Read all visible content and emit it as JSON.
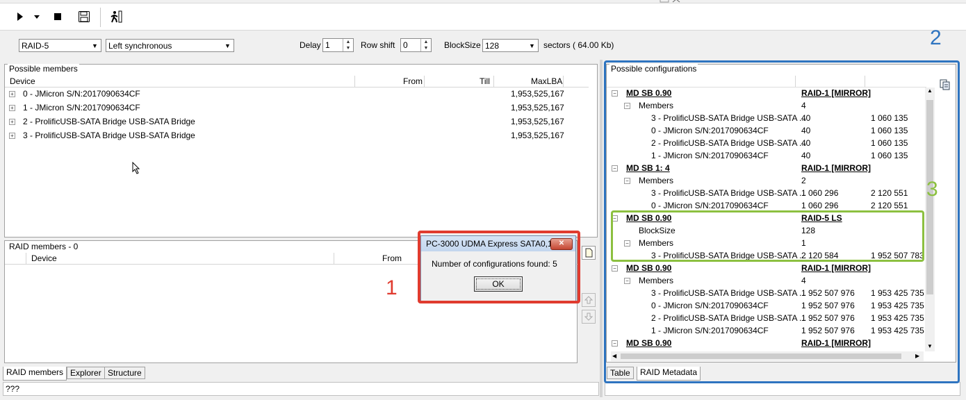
{
  "toolbar": {
    "buttons": [
      {
        "name": "play-icon",
        "glyph": "▶"
      },
      {
        "name": "dropdown-arrow-icon",
        "glyph": "▼"
      },
      {
        "name": "stop-icon",
        "glyph": "■"
      },
      {
        "name": "save-icon",
        "glyph": "💾"
      },
      {
        "name": "exit-icon",
        "glyph": "🚶"
      }
    ]
  },
  "params": {
    "raid_type": "RAID-5",
    "layout": "Left synchronous",
    "delay_label": "Delay",
    "delay_value": "1",
    "row_shift_label": "Row shift",
    "row_shift_value": "0",
    "blocksize_label": "BlockSize",
    "blocksize_value": "128",
    "sectors_text": "sectors ( 64.00 Kb)"
  },
  "possible_members": {
    "title": "Possible members",
    "columns": [
      "Device",
      "From",
      "Till",
      "MaxLBA"
    ],
    "rows": [
      {
        "device": "0 - JMicron S/N:2017090634CF",
        "maxlba": "1,953,525,167"
      },
      {
        "device": "1 - JMicron S/N:2017090634CF",
        "maxlba": "1,953,525,167"
      },
      {
        "device": "2 - ProlificUSB-SATA Bridge USB-SATA Bridge",
        "maxlba": "1,953,525,167"
      },
      {
        "device": "3 - ProlificUSB-SATA Bridge USB-SATA Bridge",
        "maxlba": "1,953,525,167"
      }
    ]
  },
  "raid_members": {
    "title": "RAID members - 0",
    "columns": [
      "Device",
      "From"
    ]
  },
  "left_tabs": [
    "RAID members",
    "Explorer",
    "Structure"
  ],
  "status_text": "???",
  "dialog": {
    "title": "PC-3000 UDMA Express SATA0,1",
    "message": "Number of configurations found: 5",
    "ok_label": "OK"
  },
  "configs": {
    "title": "Possible configurations",
    "groups": [
      {
        "name": "MD SB 0.90",
        "raid": "RAID-1 [MIRROR]",
        "members_label": "Members",
        "members_count": "4",
        "members": [
          {
            "dev": "3 - ProlificUSB-SATA Bridge USB-SATA ...",
            "a": "40",
            "b": "1 060 135"
          },
          {
            "dev": "0 - JMicron S/N:2017090634CF",
            "a": "40",
            "b": "1 060 135"
          },
          {
            "dev": "2 - ProlificUSB-SATA Bridge USB-SATA ...",
            "a": "40",
            "b": "1 060 135"
          },
          {
            "dev": "1 - JMicron S/N:2017090634CF",
            "a": "40",
            "b": "1 060 135"
          }
        ]
      },
      {
        "name": "MD SB 1: 4",
        "raid": "RAID-1 [MIRROR]",
        "members_label": "Members",
        "members_count": "2",
        "members": [
          {
            "dev": "3 - ProlificUSB-SATA Bridge USB-SATA ...",
            "a": "1 060 296",
            "b": "2 120 551"
          },
          {
            "dev": "0 - JMicron S/N:2017090634CF",
            "a": "1 060 296",
            "b": "2 120 551"
          }
        ]
      },
      {
        "name": "MD SB 0.90",
        "raid": "RAID-5 LS",
        "blocksize_label": "BlockSize",
        "blocksize": "128",
        "members_label": "Members",
        "members_count": "1",
        "members": [
          {
            "dev": "3 - ProlificUSB-SATA Bridge USB-SATA ...",
            "a": "2 120 584",
            "b": "1 952 507 783"
          }
        ]
      },
      {
        "name": "MD SB 0.90",
        "raid": "RAID-1 [MIRROR]",
        "members_label": "Members",
        "members_count": "4",
        "members": [
          {
            "dev": "3 - ProlificUSB-SATA Bridge USB-SATA ...",
            "a": "1 952 507 976",
            "b": "1 953 425 735"
          },
          {
            "dev": "0 - JMicron S/N:2017090634CF",
            "a": "1 952 507 976",
            "b": "1 953 425 735"
          },
          {
            "dev": "2 - ProlificUSB-SATA Bridge USB-SATA ...",
            "a": "1 952 507 976",
            "b": "1 953 425 735"
          },
          {
            "dev": "1 - JMicron S/N:2017090634CF",
            "a": "1 952 507 976",
            "b": "1 953 425 735"
          }
        ]
      },
      {
        "name": "MD SB 0.90",
        "raid": "RAID-1 [MIRROR]"
      }
    ]
  },
  "right_tabs": [
    "Table",
    "RAID Metadata"
  ],
  "annotations": {
    "one": "1",
    "two": "2",
    "three": "3"
  },
  "colors": {
    "red": "#e03b2f",
    "blue": "#2e74c0",
    "green": "#8cc040"
  }
}
